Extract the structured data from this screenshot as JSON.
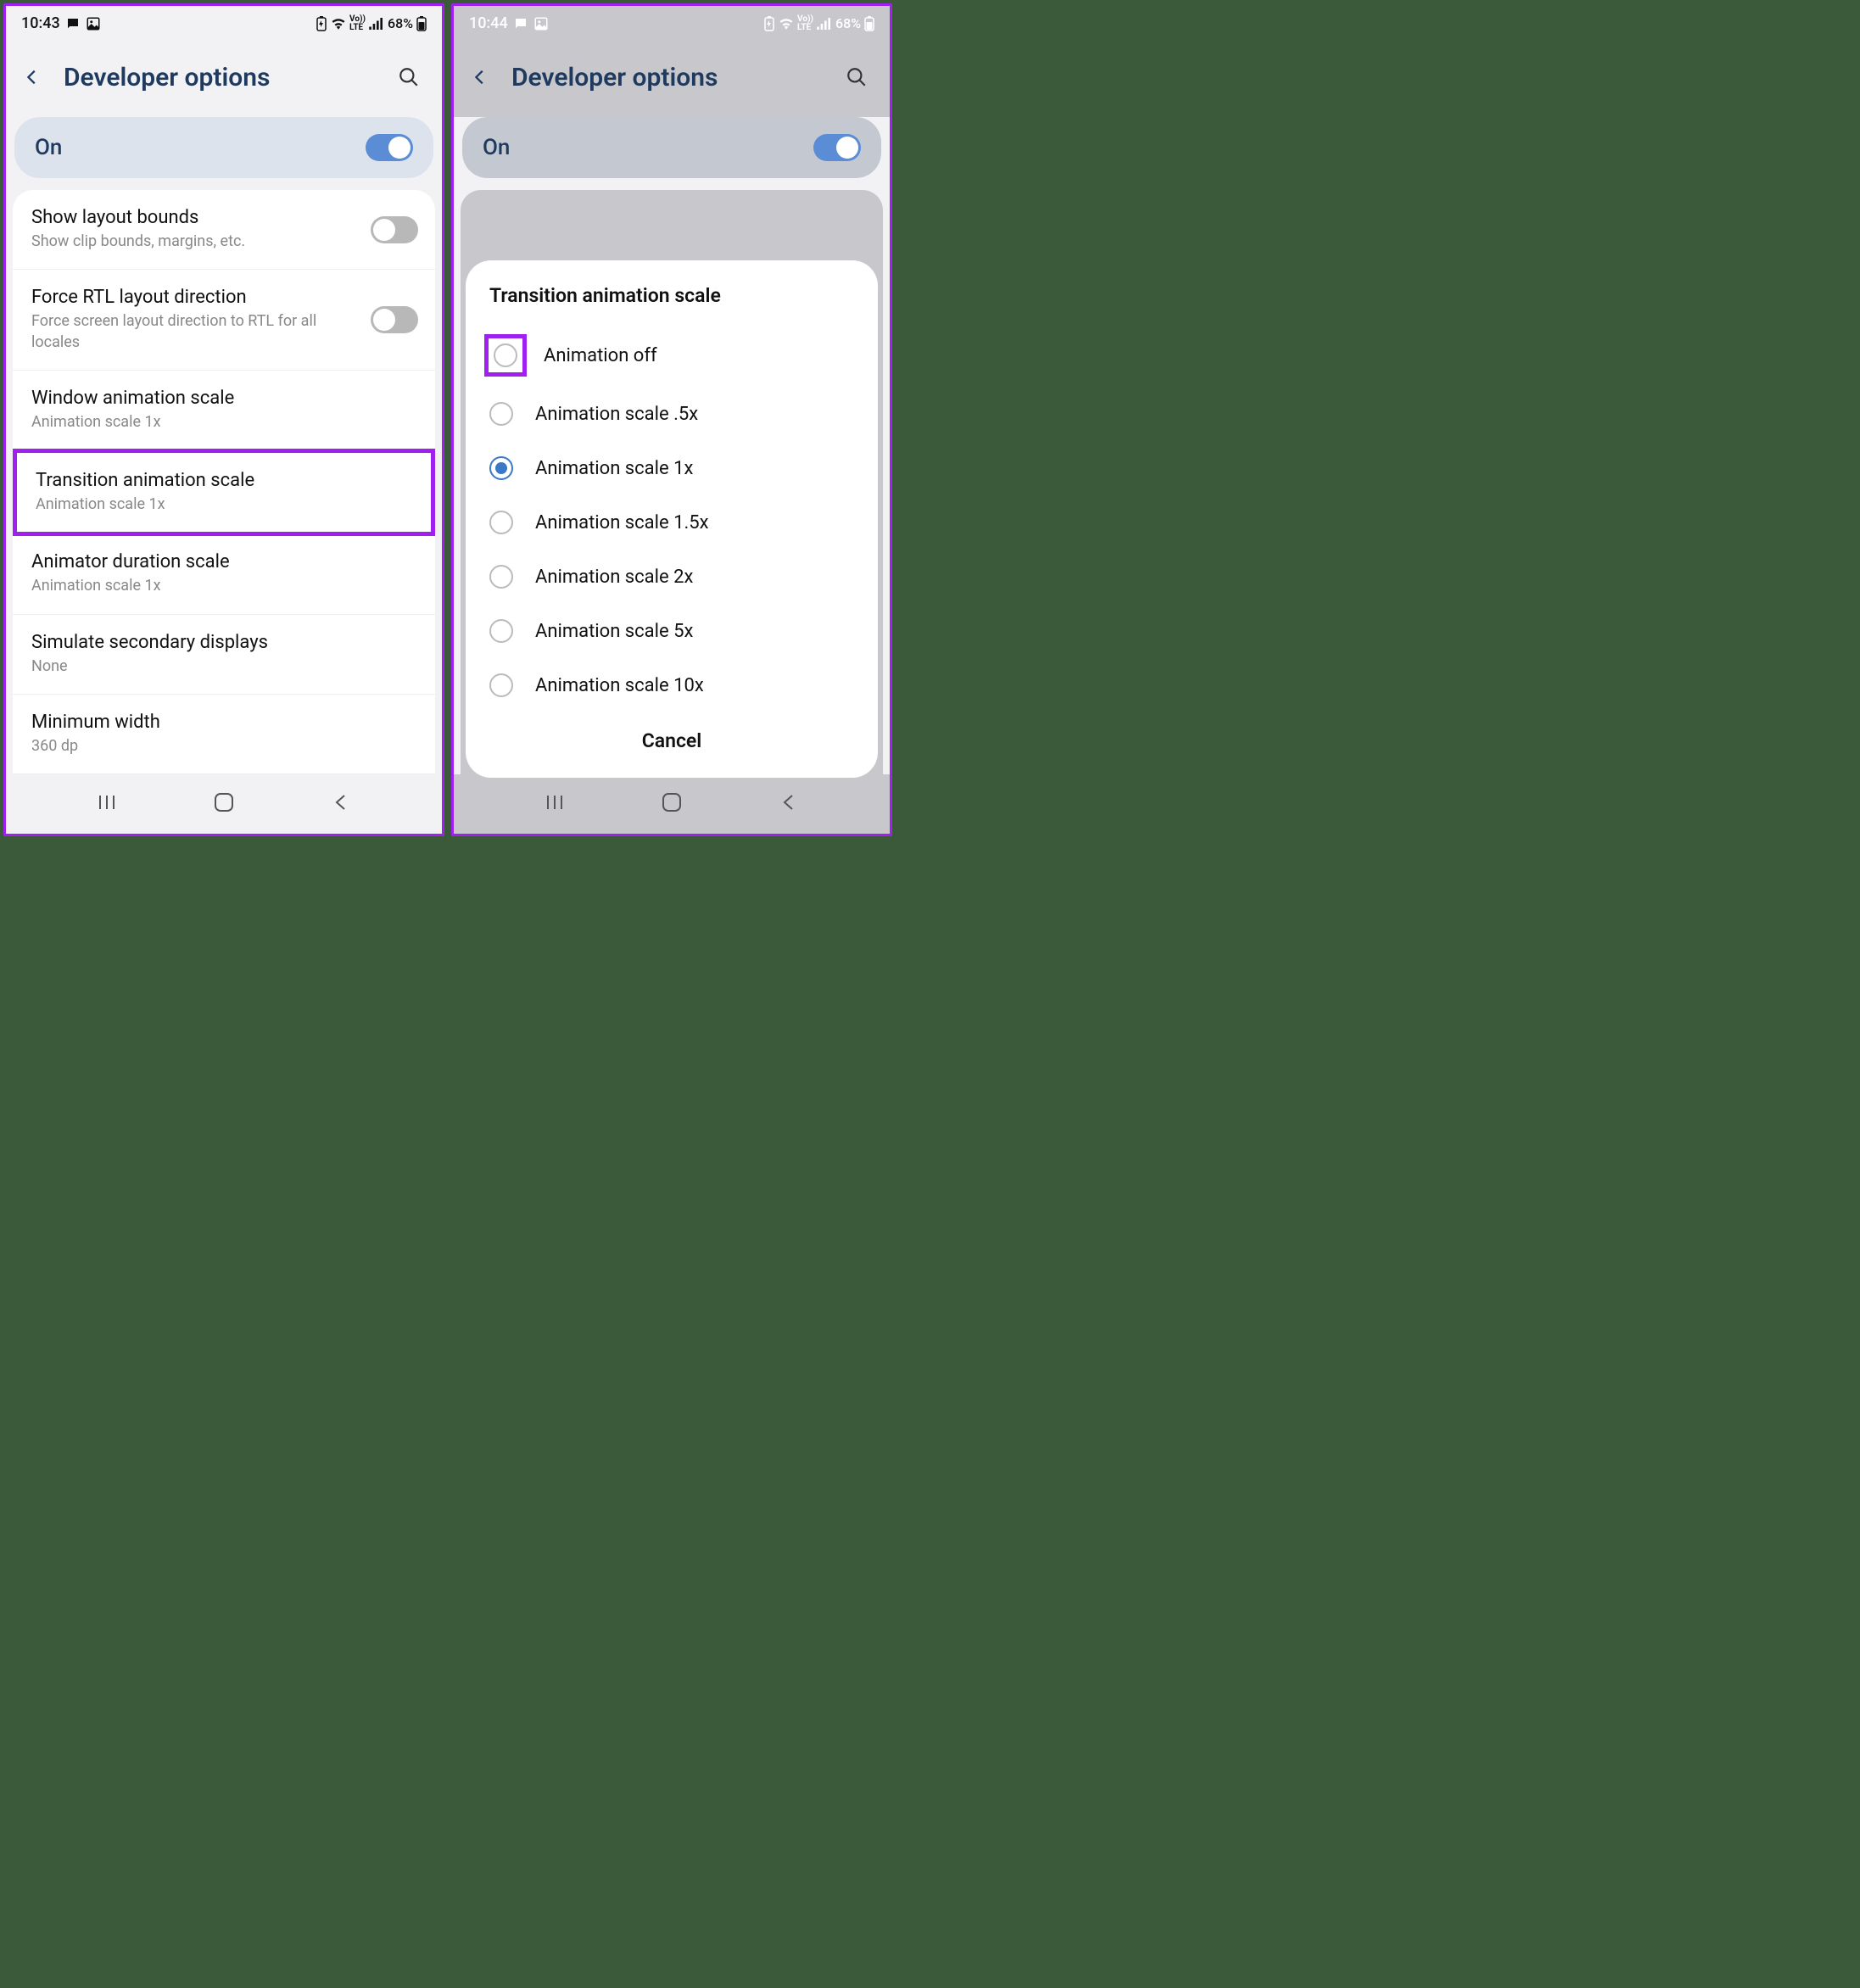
{
  "left": {
    "status": {
      "time": "10:43",
      "battery": "68%"
    },
    "header": {
      "title": "Developer options"
    },
    "on_row": {
      "label": "On",
      "enabled": true
    },
    "settings": [
      {
        "title": "Show layout bounds",
        "sub": "Show clip bounds, margins, etc.",
        "toggle": false
      },
      {
        "title": "Force RTL layout direction",
        "sub": "Force screen layout direction to RTL for all locales",
        "toggle": false
      },
      {
        "title": "Window animation scale",
        "sub": "Animation scale 1x"
      },
      {
        "title": "Transition animation scale",
        "sub": "Animation scale 1x",
        "highlighted": true
      },
      {
        "title": "Animator duration scale",
        "sub": "Animation scale 1x"
      },
      {
        "title": "Simulate secondary displays",
        "sub": "None"
      },
      {
        "title": "Minimum width",
        "sub": "360 dp"
      }
    ]
  },
  "right": {
    "status": {
      "time": "10:44",
      "battery": "68%"
    },
    "header": {
      "title": "Developer options"
    },
    "on_row": {
      "label": "On",
      "enabled": true
    },
    "dialog": {
      "title": "Transition animation scale",
      "options": [
        {
          "label": "Animation off",
          "selected": false,
          "highlighted": true
        },
        {
          "label": "Animation scale .5x",
          "selected": false
        },
        {
          "label": "Animation scale 1x",
          "selected": true
        },
        {
          "label": "Animation scale 1.5x",
          "selected": false
        },
        {
          "label": "Animation scale 2x",
          "selected": false
        },
        {
          "label": "Animation scale 5x",
          "selected": false
        },
        {
          "label": "Animation scale 10x",
          "selected": false
        }
      ],
      "cancel": "Cancel"
    }
  }
}
